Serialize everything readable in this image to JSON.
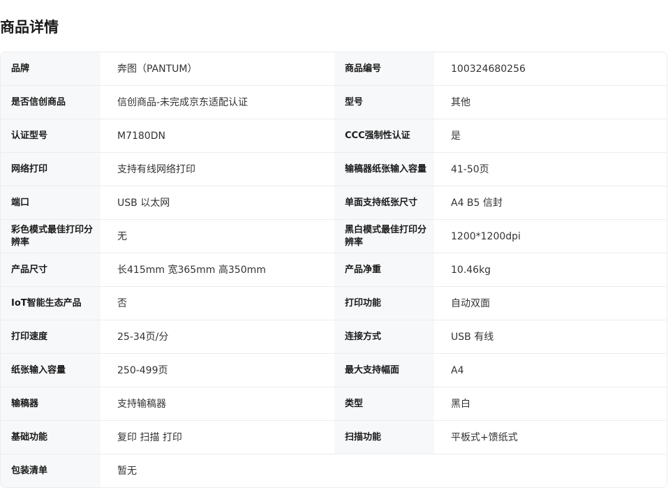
{
  "page": {
    "title": "商品详情"
  },
  "specs": [
    {
      "k1": "品牌",
      "v1": "奔图（PANTUM）",
      "k2": "商品编号",
      "v2": "100324680256"
    },
    {
      "k1": "是否信创商品",
      "v1": "信创商品-未完成京东适配认证",
      "k2": "型号",
      "v2": "其他"
    },
    {
      "k1": "认证型号",
      "v1": "M7180DN",
      "k2": "CCC强制性认证",
      "v2": "是"
    },
    {
      "k1": "网络打印",
      "v1": "支持有线网络打印",
      "k2": "输稿器纸张输入容量",
      "v2": "41-50页"
    },
    {
      "k1": "端口",
      "v1": "USB 以太网",
      "k2": "单面支持纸张尺寸",
      "v2": "A4 B5 信封"
    },
    {
      "k1": "彩色模式最佳打印分辨率",
      "v1": "无",
      "k2": "黑白模式最佳打印分辨率",
      "v2": "1200*1200dpi"
    },
    {
      "k1": "产品尺寸",
      "v1": "长415mm 宽365mm 高350mm",
      "k2": "产品净重",
      "v2": "10.46kg"
    },
    {
      "k1": "IoT智能生态产品",
      "v1": "否",
      "k2": "打印功能",
      "v2": "自动双面"
    },
    {
      "k1": "打印速度",
      "v1": "25-34页/分",
      "k2": "连接方式",
      "v2": "USB 有线"
    },
    {
      "k1": "纸张输入容量",
      "v1": "250-499页",
      "k2": "最大支持幅面",
      "v2": "A4"
    },
    {
      "k1": "输稿器",
      "v1": "支持输稿器",
      "k2": "类型",
      "v2": "黑白"
    },
    {
      "k1": "基础功能",
      "v1": "复印 扫描 打印",
      "k2": "扫描功能",
      "v2": "平板式+馈纸式"
    },
    {
      "k1": "包装清单",
      "v1": "暂无"
    }
  ]
}
